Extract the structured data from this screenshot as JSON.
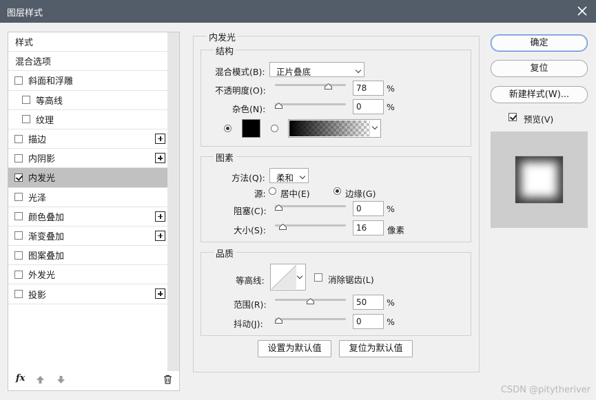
{
  "window": {
    "title": "图层样式"
  },
  "styles_list": {
    "items": [
      {
        "label": "样式",
        "checkbox": false,
        "checked": false,
        "plus": false,
        "indent": false,
        "selected": false
      },
      {
        "label": "混合选项",
        "checkbox": false,
        "checked": false,
        "plus": false,
        "indent": false,
        "selected": false
      },
      {
        "label": "斜面和浮雕",
        "checkbox": true,
        "checked": false,
        "plus": false,
        "indent": false,
        "selected": false
      },
      {
        "label": "等高线",
        "checkbox": true,
        "checked": false,
        "plus": false,
        "indent": true,
        "selected": false
      },
      {
        "label": "纹理",
        "checkbox": true,
        "checked": false,
        "plus": false,
        "indent": true,
        "selected": false
      },
      {
        "label": "描边",
        "checkbox": true,
        "checked": false,
        "plus": true,
        "indent": false,
        "selected": false
      },
      {
        "label": "内阴影",
        "checkbox": true,
        "checked": false,
        "plus": true,
        "indent": false,
        "selected": false
      },
      {
        "label": "内发光",
        "checkbox": true,
        "checked": true,
        "plus": false,
        "indent": false,
        "selected": true
      },
      {
        "label": "光泽",
        "checkbox": true,
        "checked": false,
        "plus": false,
        "indent": false,
        "selected": false
      },
      {
        "label": "颜色叠加",
        "checkbox": true,
        "checked": false,
        "plus": true,
        "indent": false,
        "selected": false
      },
      {
        "label": "渐变叠加",
        "checkbox": true,
        "checked": false,
        "plus": true,
        "indent": false,
        "selected": false
      },
      {
        "label": "图案叠加",
        "checkbox": true,
        "checked": false,
        "plus": false,
        "indent": false,
        "selected": false
      },
      {
        "label": "外发光",
        "checkbox": true,
        "checked": false,
        "plus": false,
        "indent": false,
        "selected": false
      },
      {
        "label": "投影",
        "checkbox": true,
        "checked": false,
        "plus": true,
        "indent": false,
        "selected": false
      }
    ],
    "fx_label": "fx"
  },
  "inner_glow": {
    "title": "内发光",
    "structure": {
      "title": "结构",
      "blend_mode_label": "混合模式(B):",
      "blend_mode_value": "正片叠底",
      "opacity_label": "不透明度(O):",
      "opacity_value": "78",
      "opacity_unit": "%",
      "opacity_level": 0.78,
      "noise_label": "杂色(N):",
      "noise_value": "0",
      "noise_unit": "%",
      "noise_level": 0,
      "color": "#000000"
    },
    "elements": {
      "title": "图素",
      "technique_label": "方法(Q):",
      "technique_value": "柔和",
      "source_label": "源:",
      "source_center_label": "居中(E)",
      "source_edge_label": "边缘(G)",
      "choke_label": "阻塞(C):",
      "choke_value": "0",
      "choke_unit": "%",
      "choke_level": 0,
      "size_label": "大小(S):",
      "size_value": "16",
      "size_unit": "像素",
      "size_level": 0.064
    },
    "quality": {
      "title": "品质",
      "contour_label": "等高线:",
      "antialias_label": "消除锯齿(L)",
      "range_label": "范围(R):",
      "range_value": "50",
      "range_unit": "%",
      "range_level": 0.5,
      "jitter_label": "抖动(J):",
      "jitter_value": "0",
      "jitter_unit": "%",
      "jitter_level": 0
    },
    "set_default_label": "设置为默认值",
    "reset_default_label": "复位为默认值"
  },
  "buttons": {
    "ok_label": "确定",
    "reset_label": "复位",
    "new_style_label": "新建样式(W)...",
    "preview_label": "预览(V)"
  },
  "watermark": "CSDN @pitytheriver"
}
